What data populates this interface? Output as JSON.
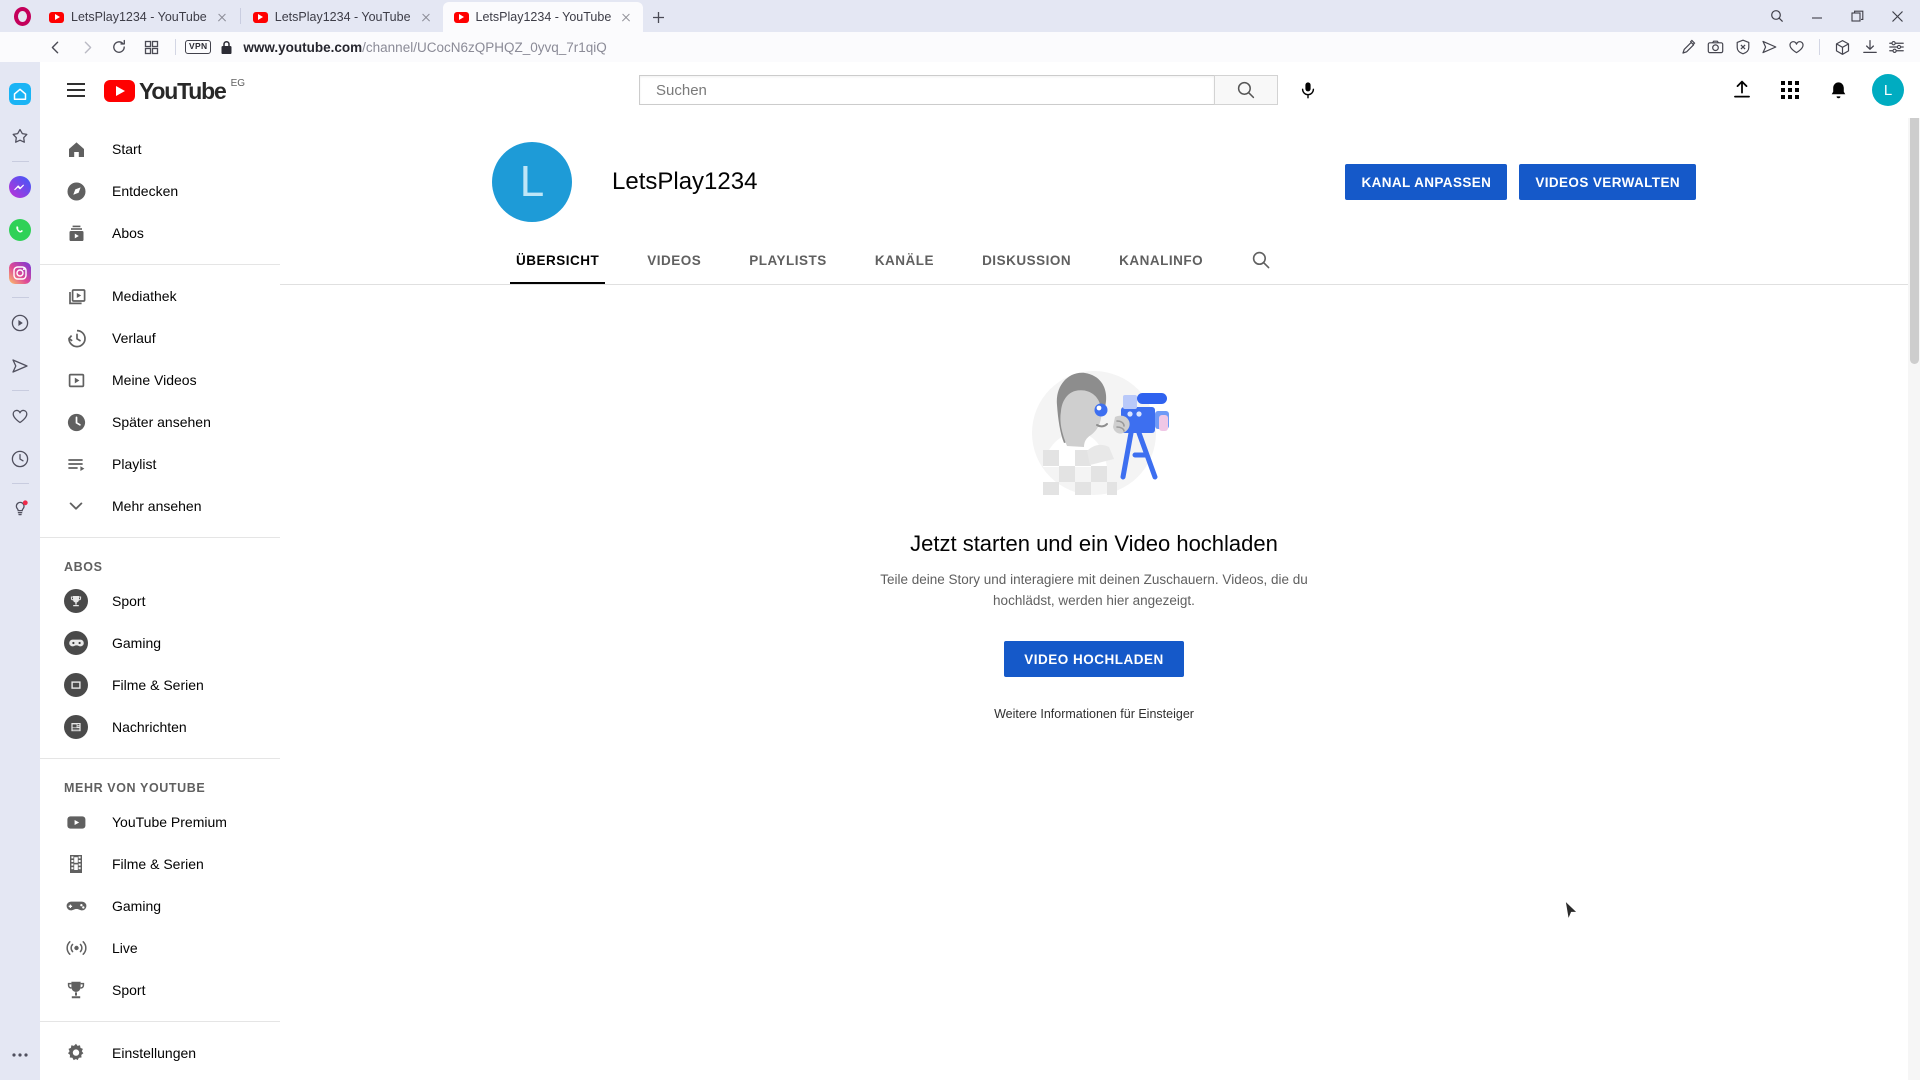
{
  "browser": {
    "app": "Opera",
    "tabs": [
      {
        "title": "LetsPlay1234 - YouTube",
        "favicon": "youtube-icon",
        "active": false
      },
      {
        "title": "LetsPlay1234 - YouTube",
        "favicon": "youtube-icon",
        "active": false
      },
      {
        "title": "LetsPlay1234 - YouTube",
        "favicon": "youtube-icon",
        "active": true
      }
    ],
    "new_tab_label": "+",
    "window_controls": [
      "search-icon",
      "minimize-icon",
      "restore-icon",
      "close-icon"
    ],
    "nav": {
      "back": "back-icon",
      "forward": "forward-icon",
      "reload": "reload-icon",
      "tab_grid": "tab-grid-icon"
    },
    "vpn_badge": "VPN",
    "url_prefix": "www.youtube.com",
    "url_path": "/channel/UCocN6zQPHQZ_0yvq_7r1qiQ",
    "url_full": "www.youtube.com/channel/UCocN6zQPHQZ_0yvq_7r1qiQ",
    "toolbar_icons": [
      "pin-edit-icon",
      "camera-snapshot-icon",
      "ad-block-shield-icon",
      "send-icon",
      "heart-icon",
      "crypto-wallet-cube-icon",
      "download-icon",
      "easy-setup-sliders-icon"
    ],
    "sidebar_items": [
      "home-icon",
      "bookmarks-star-icon",
      "messenger-icon",
      "whatsapp-icon",
      "instagram-icon",
      "player-icon",
      "telegram-icon",
      "favorites-heart-icon",
      "history-clock-icon",
      "tips-bulb-icon"
    ],
    "sidebar_menu": "more-dots-icon"
  },
  "youtube": {
    "header": {
      "menu": "hamburger-menu-icon",
      "logo_text": "YouTube",
      "country_code": "EG",
      "search_placeholder": "Suchen",
      "search_value": "",
      "search_button": "search-icon",
      "mic_button": "microphone-icon",
      "upload_button": "upload-icon",
      "apps_button": "apps-grid-icon",
      "notifications_button": "bell-icon",
      "avatar_letter": "L"
    },
    "sidebar": {
      "main": [
        {
          "label": "Start",
          "icon": "home-icon"
        },
        {
          "label": "Entdecken",
          "icon": "compass-icon"
        },
        {
          "label": "Abos",
          "icon": "subscriptions-icon"
        }
      ],
      "library": [
        {
          "label": "Mediathek",
          "icon": "library-icon"
        },
        {
          "label": "Verlauf",
          "icon": "history-icon"
        },
        {
          "label": "Meine Videos",
          "icon": "my-videos-icon"
        },
        {
          "label": "Später ansehen",
          "icon": "watch-later-clock-icon"
        },
        {
          "label": "Playlist",
          "icon": "playlist-icon"
        },
        {
          "label": "Mehr ansehen",
          "icon": "chevron-down-icon"
        }
      ],
      "subs_heading": "ABOS",
      "subs": [
        {
          "label": "Sport",
          "icon": "trophy-channel-icon"
        },
        {
          "label": "Gaming",
          "icon": "gaming-channel-icon"
        },
        {
          "label": "Filme & Serien",
          "icon": "movies-channel-icon"
        },
        {
          "label": "Nachrichten",
          "icon": "news-channel-icon"
        }
      ],
      "more_heading": "MEHR VON YOUTUBE",
      "more": [
        {
          "label": "YouTube Premium",
          "icon": "youtube-premium-icon"
        },
        {
          "label": "Filme & Serien",
          "icon": "film-strip-icon"
        },
        {
          "label": "Gaming",
          "icon": "gamepad-icon"
        },
        {
          "label": "Live",
          "icon": "live-broadcast-icon"
        },
        {
          "label": "Sport",
          "icon": "trophy-icon"
        }
      ],
      "settings": [
        {
          "label": "Einstellungen",
          "icon": "gear-icon"
        }
      ]
    },
    "channel": {
      "avatar_letter": "L",
      "name": "LetsPlay1234",
      "customize_button": "KANAL ANPASSEN",
      "manage_button": "VIDEOS VERWALTEN",
      "tabs": [
        {
          "label": "ÜBERSICHT",
          "active": true
        },
        {
          "label": "VIDEOS",
          "active": false
        },
        {
          "label": "PLAYLISTS",
          "active": false
        },
        {
          "label": "KANÄLE",
          "active": false
        },
        {
          "label": "DISKUSSION",
          "active": false
        },
        {
          "label": "KANALINFO",
          "active": false
        }
      ],
      "tab_search_icon": "search-icon"
    },
    "empty_state": {
      "illustration": "person-with-video-camera-illustration",
      "title": "Jetzt starten und ein Video hochladen",
      "subtitle": "Teile deine Story und interagiere mit deinen Zuschauern. Videos, die du hochlädst, werden hier angezeigt.",
      "upload_button": "VIDEO HOCHLADEN",
      "help_link": "Weitere Informationen für Einsteiger"
    }
  },
  "colors": {
    "youtube_red": "#ff0000",
    "button_blue": "#1559c9",
    "avatar_cyan": "#1e9bd7",
    "opera_red": "#c4005a"
  }
}
